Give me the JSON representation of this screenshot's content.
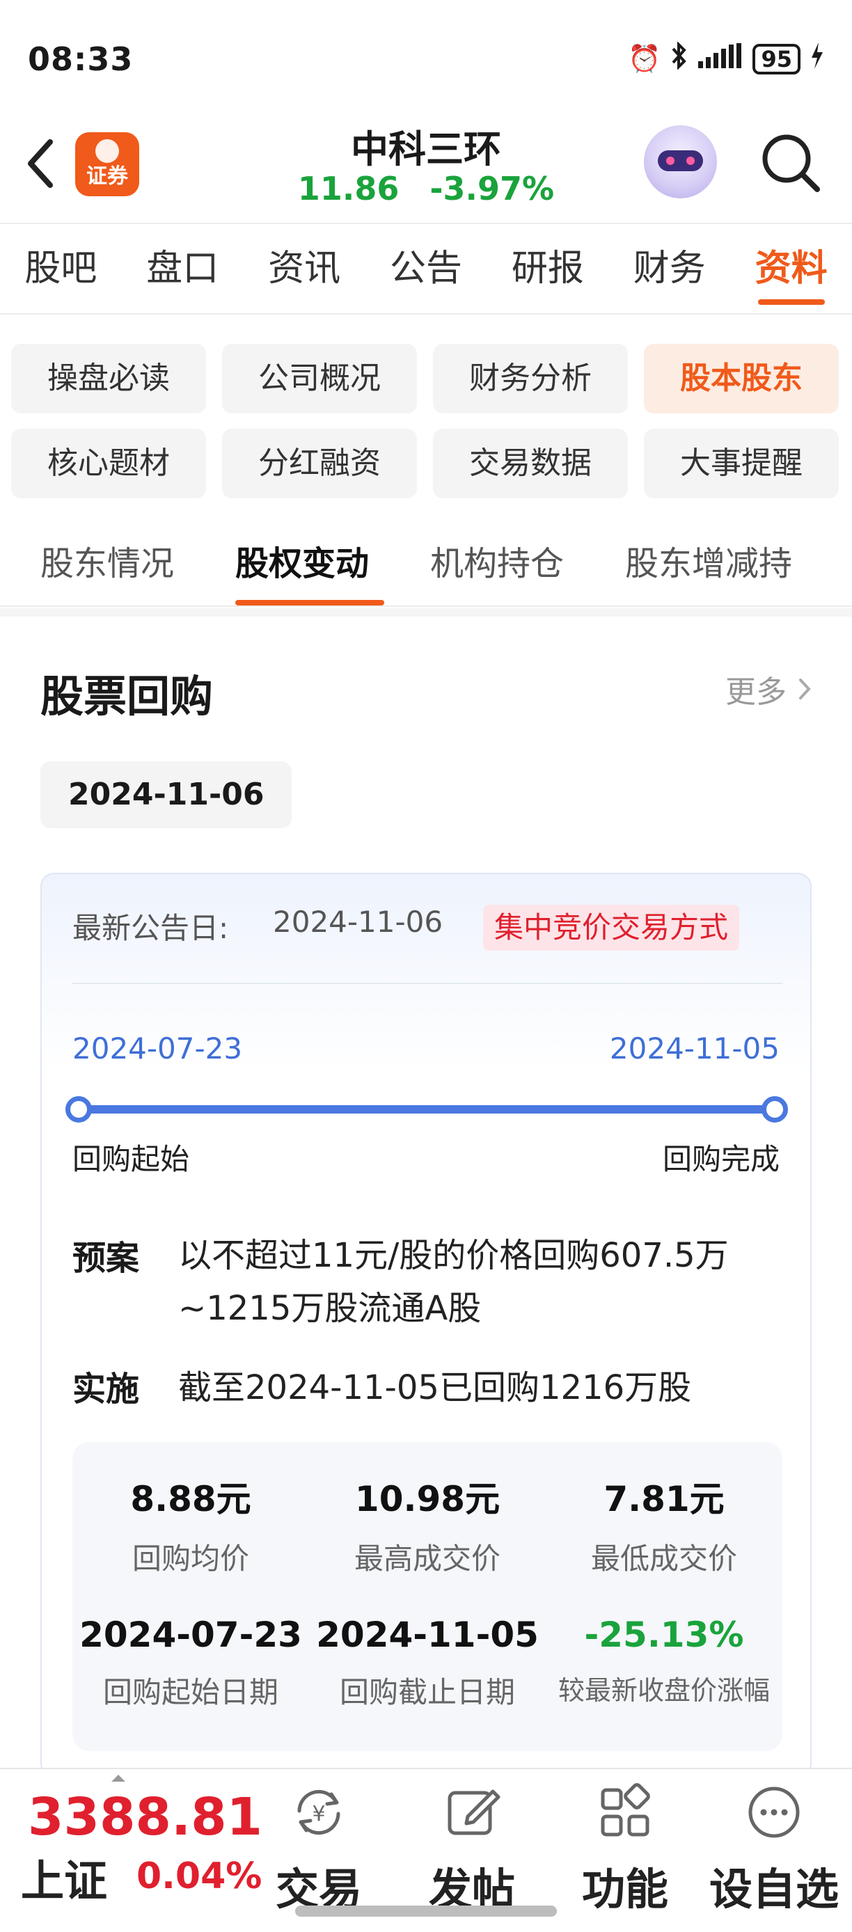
{
  "status_bar": {
    "time": "08:33",
    "battery": "95"
  },
  "header": {
    "stock_name": "中科三环",
    "price": "11.86",
    "change": "-3.97%",
    "logo_text": "证券"
  },
  "main_tabs": [
    "股吧",
    "盘口",
    "资讯",
    "公告",
    "研报",
    "财务",
    "资料"
  ],
  "sub_items": [
    "操盘必读",
    "公司概况",
    "财务分析",
    "股本股东",
    "核心题材",
    "分红融资",
    "交易数据",
    "大事提醒"
  ],
  "second_tabs": [
    "股东情况",
    "股权变动",
    "机构持仓",
    "股东增减持"
  ],
  "section": {
    "title": "股票回购",
    "more": "更多",
    "date_chip": "2024-11-06"
  },
  "card": {
    "announce_label": "最新公告日:",
    "announce_date": "2024-11-06",
    "method_tag": "集中竞价交易方式",
    "timeline": {
      "start_date": "2024-07-23",
      "end_date": "2024-11-05",
      "start_label": "回购起始",
      "end_label": "回购完成"
    },
    "plan_label": "预案",
    "plan_text": "以不超过11元/股的价格回购607.5万~1215万股流通A股",
    "impl_label": "实施",
    "impl_text": "截至2024-11-05已回购1216万股",
    "stats": [
      {
        "value": "8.88元",
        "label": "回购均价"
      },
      {
        "value": "10.98元",
        "label": "最高成交价"
      },
      {
        "value": "7.81元",
        "label": "最低成交价"
      },
      {
        "value": "2024-07-23",
        "label": "回购起始日期"
      },
      {
        "value": "2024-11-05",
        "label": "回购截止日期"
      },
      {
        "value": "-25.13%",
        "label": "较最新收盘价涨幅"
      }
    ]
  },
  "bottom_bar": {
    "index_value": "3388.81",
    "index_name": "上证",
    "index_change": "0.04%",
    "nav": [
      {
        "label": "交易",
        "icon": "yuan-exchange-icon"
      },
      {
        "label": "发帖",
        "icon": "edit-post-icon"
      },
      {
        "label": "功能",
        "icon": "grid-function-icon"
      },
      {
        "label": "设自选",
        "icon": "more-dots-icon"
      }
    ]
  },
  "colors": {
    "accent": "#f05a1a",
    "down_green": "#1aa33c",
    "up_red": "#e0202e",
    "timeline_blue": "#4a78e0"
  }
}
